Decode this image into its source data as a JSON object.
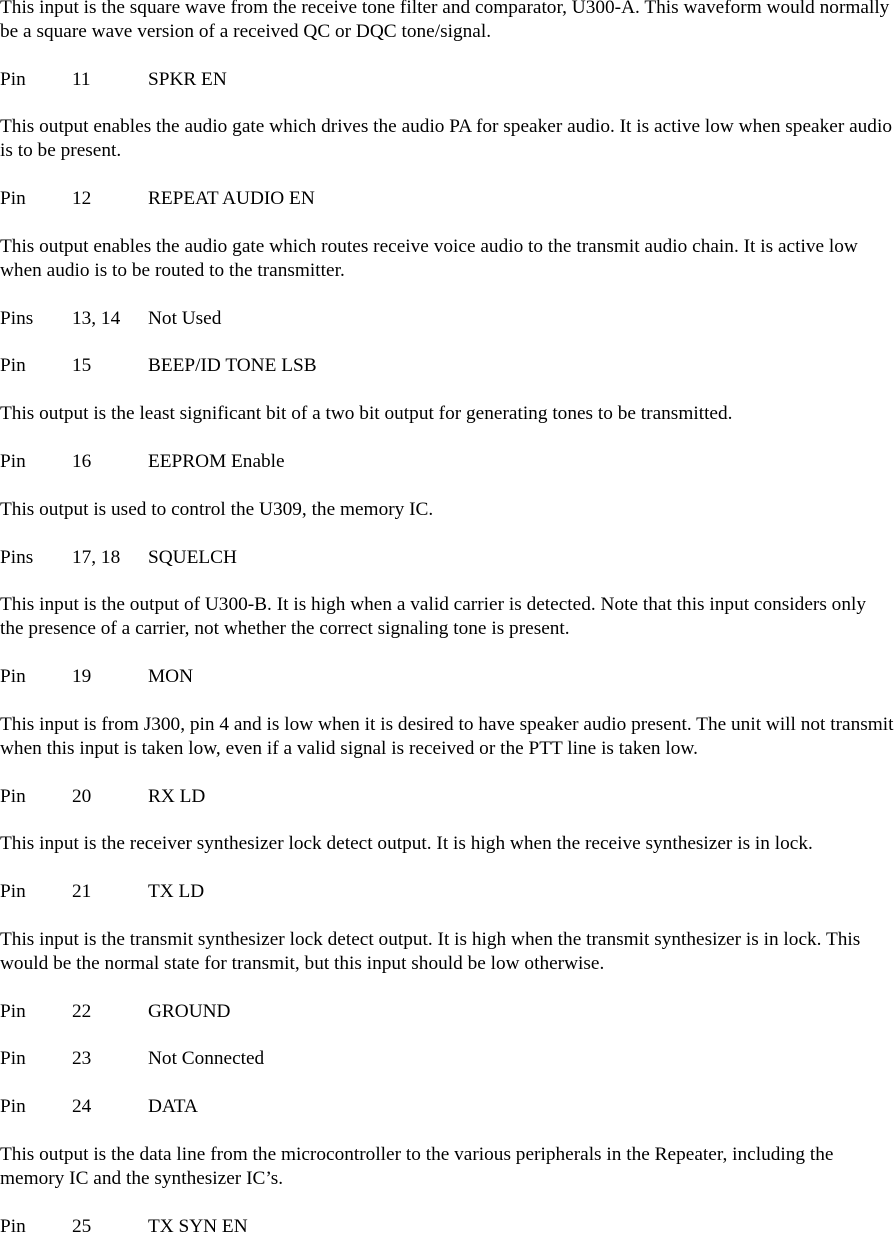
{
  "document": {
    "type": "technical-manual-page",
    "font_style": "serif",
    "background_color": "#ffffff",
    "text_color": "#000000",
    "blocks": [
      {
        "kind": "paragraph",
        "text": "This input is the square wave from the receive tone filter and comparator, U300-A.  This waveform would normally be a square wave version of a received QC or DQC tone/signal."
      },
      {
        "kind": "pin",
        "label": "Pin",
        "number": "11",
        "name": "SPKR EN"
      },
      {
        "kind": "paragraph",
        "text": "This output enables the audio gate which drives the audio PA for speaker audio.  It is active low when speaker audio is to be present."
      },
      {
        "kind": "pin",
        "label": "Pin",
        "number": "12",
        "name": "REPEAT AUDIO EN"
      },
      {
        "kind": "paragraph",
        "text": "This output enables the audio gate which routes receive voice audio to the transmit audio chain.  It is active low when audio is to be routed to the transmitter."
      },
      {
        "kind": "pin",
        "label": "Pins",
        "number": "13, 14",
        "name": "Not Used"
      },
      {
        "kind": "pin",
        "label": "Pin",
        "number": "15",
        "name": "BEEP/ID TONE LSB"
      },
      {
        "kind": "paragraph",
        "text": "This output is the least significant bit of a two bit output for generating tones to be transmitted."
      },
      {
        "kind": "pin",
        "label": "Pin",
        "number": "16",
        "name": "EEPROM Enable"
      },
      {
        "kind": "paragraph",
        "text": "This output is used to control the U309, the memory IC."
      },
      {
        "kind": "pin",
        "label": "Pins",
        "number": "17, 18",
        "name": "SQUELCH"
      },
      {
        "kind": "paragraph",
        "text": "This input is the output of U300-B.  It is high when a valid carrier is detected.  Note that this input considers only the presence of a carrier, not whether the correct signaling tone is present."
      },
      {
        "kind": "pin",
        "label": "Pin",
        "number": "19",
        "name": "MON"
      },
      {
        "kind": "paragraph",
        "text": "This input is from J300, pin 4 and is low when it is desired to have speaker audio present.  The unit will not transmit when this input is taken low, even if a valid signal is received or the PTT line is taken low."
      },
      {
        "kind": "pin",
        "label": "Pin",
        "number": "20",
        "name": "RX LD"
      },
      {
        "kind": "paragraph",
        "text": "This input is the receiver synthesizer lock detect output.  It is high when the receive synthesizer is in lock."
      },
      {
        "kind": "pin",
        "label": "Pin",
        "number": "21",
        "name": "TX LD"
      },
      {
        "kind": "paragraph",
        "text": "This input is the transmit synthesizer lock detect output.  It is high when the transmit synthesizer is in lock.  This would be the normal state for transmit, but this input should be low otherwise."
      },
      {
        "kind": "pin",
        "label": "Pin",
        "number": "22",
        "name": "GROUND"
      },
      {
        "kind": "pin",
        "label": "Pin",
        "number": "23",
        "name": "Not Connected"
      },
      {
        "kind": "pin",
        "label": "Pin",
        "number": "24",
        "name": "DATA"
      },
      {
        "kind": "paragraph",
        "text": "This output is the data line from the microcontroller to the various peripherals in the Repeater, including the memory IC and the synthesizer IC’s."
      },
      {
        "kind": "pin",
        "label": "Pin",
        "number": "25",
        "name": "TX SYN EN"
      }
    ]
  }
}
